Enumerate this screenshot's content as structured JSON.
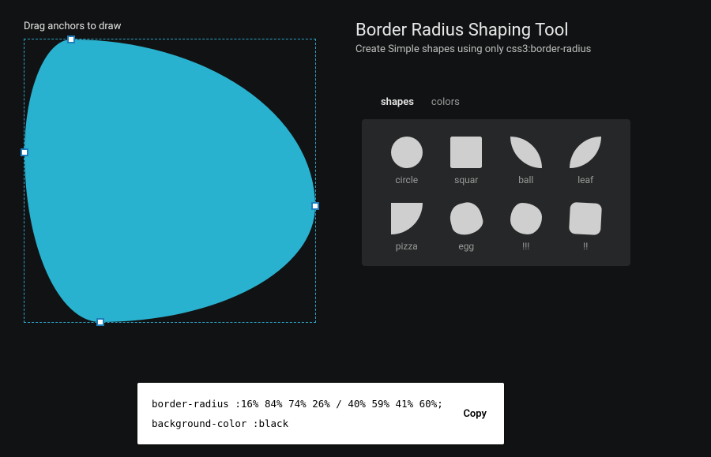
{
  "canvas": {
    "hint": "Drag anchors to draw",
    "fill_color": "#29b2cf",
    "border_radius": "16% 84% 74% 26% / 40% 59% 41% 60%"
  },
  "header": {
    "title": "Border Radius Shaping Tool",
    "subtitle": "Create Simple shapes using only css3:border-radius"
  },
  "tabs": {
    "shapes": "shapes",
    "colors": "colors",
    "active": "shapes"
  },
  "presets": {
    "circle": "circle",
    "square": "squar",
    "ball": "ball",
    "leaf": "leaf",
    "pizza": "pizza",
    "egg": "egg",
    "blob1": "!!!",
    "blob2": "!!"
  },
  "code": {
    "line1": "border-radius :16% 84% 74% 26% / 40% 59% 41% 60%;",
    "line2": "background-color :black",
    "copy_label": "Copy"
  }
}
